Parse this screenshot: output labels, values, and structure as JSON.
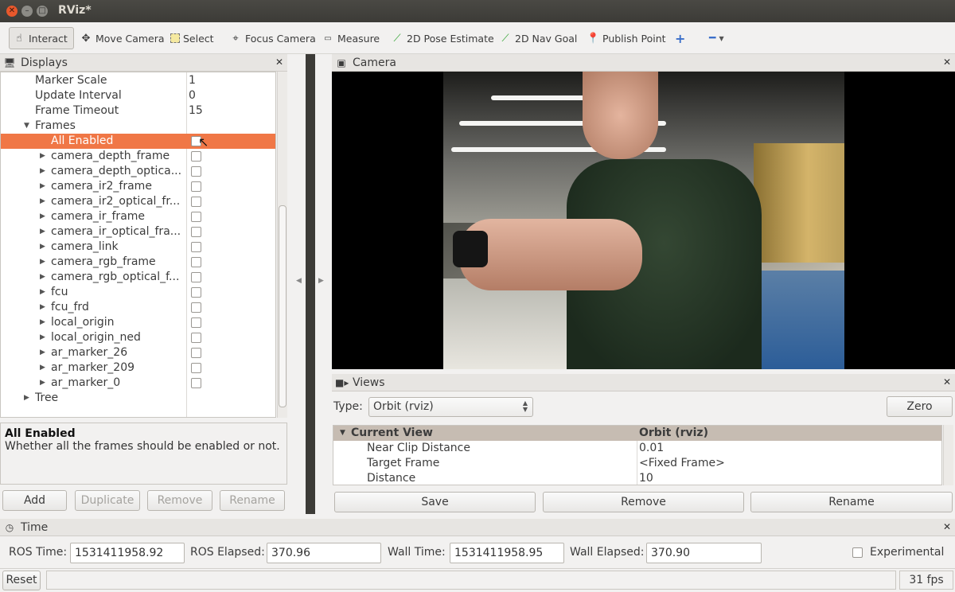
{
  "window": {
    "title": "RViz*"
  },
  "toolbar": {
    "items": [
      {
        "label": "Interact",
        "icon": "hand-icon"
      },
      {
        "label": "Move Camera",
        "icon": "move-camera-icon"
      },
      {
        "label": "Select",
        "icon": "select-icon"
      },
      {
        "label": "Focus Camera",
        "icon": "focus-icon"
      },
      {
        "label": "Measure",
        "icon": "ruler-icon"
      },
      {
        "label": "2D Pose Estimate",
        "icon": "green-arrow-icon"
      },
      {
        "label": "2D Nav Goal",
        "icon": "green-arrow-icon"
      },
      {
        "label": "Publish Point",
        "icon": "map-pin-icon"
      }
    ]
  },
  "displays": {
    "title": "Displays",
    "rows": [
      {
        "name": "Marker Scale",
        "value": "1"
      },
      {
        "name": "Update Interval",
        "value": "0"
      },
      {
        "name": "Frame Timeout",
        "value": "15"
      },
      {
        "name": "Frames",
        "value": ""
      },
      {
        "name": "All Enabled",
        "value": ""
      },
      {
        "name": "camera_depth_frame",
        "value": ""
      },
      {
        "name": "camera_depth_optica...",
        "value": ""
      },
      {
        "name": "camera_ir2_frame",
        "value": ""
      },
      {
        "name": "camera_ir2_optical_fr...",
        "value": ""
      },
      {
        "name": "camera_ir_frame",
        "value": ""
      },
      {
        "name": "camera_ir_optical_fra...",
        "value": ""
      },
      {
        "name": "camera_link",
        "value": ""
      },
      {
        "name": "camera_rgb_frame",
        "value": ""
      },
      {
        "name": "camera_rgb_optical_f...",
        "value": ""
      },
      {
        "name": "fcu",
        "value": ""
      },
      {
        "name": "fcu_frd",
        "value": ""
      },
      {
        "name": "local_origin",
        "value": ""
      },
      {
        "name": "local_origin_ned",
        "value": ""
      },
      {
        "name": "ar_marker_26",
        "value": ""
      },
      {
        "name": "ar_marker_209",
        "value": ""
      },
      {
        "name": "ar_marker_0",
        "value": ""
      },
      {
        "name": "Tree",
        "value": ""
      }
    ],
    "description": {
      "title": "All Enabled",
      "text": "Whether all the frames should be enabled or not."
    },
    "buttons": {
      "add": "Add",
      "duplicate": "Duplicate",
      "remove": "Remove",
      "rename": "Rename"
    }
  },
  "camera": {
    "title": "Camera"
  },
  "views": {
    "title": "Views",
    "type_label": "Type:",
    "type_value": "Orbit (rviz)",
    "zero": "Zero",
    "table": [
      {
        "name": "Current View",
        "value": "Orbit (rviz)"
      },
      {
        "name": "Near Clip Distance",
        "value": "0.01"
      },
      {
        "name": "Target Frame",
        "value": "<Fixed Frame>"
      },
      {
        "name": "Distance",
        "value": "10"
      }
    ],
    "buttons": {
      "save": "Save",
      "remove": "Remove",
      "rename": "Rename"
    }
  },
  "time": {
    "title": "Time",
    "ros_time_label": "ROS Time:",
    "ros_time": "1531411958.92",
    "ros_elapsed_label": "ROS Elapsed:",
    "ros_elapsed": "370.96",
    "wall_time_label": "Wall Time:",
    "wall_time": "1531411958.95",
    "wall_elapsed_label": "Wall Elapsed:",
    "wall_elapsed": "370.90",
    "experimental": "Experimental"
  },
  "status": {
    "reset": "Reset",
    "fps": "31 fps"
  }
}
